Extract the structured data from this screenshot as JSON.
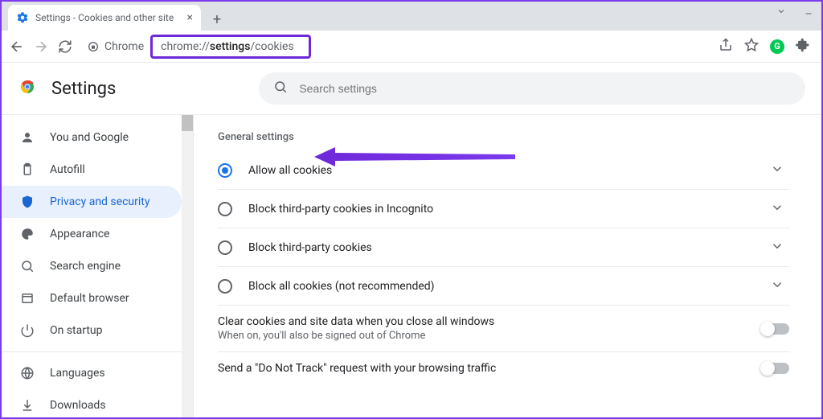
{
  "browser": {
    "tab_title": "Settings - Cookies and other site",
    "new_tab_label": "+",
    "address_prefix": "Chrome",
    "address_url_before": "chrome://",
    "address_url_bold": "settings",
    "address_url_after": "/cookies"
  },
  "settings": {
    "app_title": "Settings",
    "search_placeholder": "Search settings",
    "sidebar": {
      "items": [
        {
          "label": "You and Google",
          "icon": "person"
        },
        {
          "label": "Autofill",
          "icon": "clipboard"
        },
        {
          "label": "Privacy and security",
          "icon": "shield",
          "active": true
        },
        {
          "label": "Appearance",
          "icon": "palette"
        },
        {
          "label": "Search engine",
          "icon": "search"
        },
        {
          "label": "Default browser",
          "icon": "window"
        },
        {
          "label": "On startup",
          "icon": "power"
        }
      ],
      "items_more": [
        {
          "label": "Languages",
          "icon": "globe"
        },
        {
          "label": "Downloads",
          "icon": "download"
        }
      ]
    },
    "section_title": "General settings",
    "radio_options": [
      {
        "label": "Allow all cookies",
        "selected": true
      },
      {
        "label": "Block third-party cookies in Incognito",
        "selected": false
      },
      {
        "label": "Block third-party cookies",
        "selected": false
      },
      {
        "label": "Block all cookies (not recommended)",
        "selected": false
      }
    ],
    "toggle_rows": [
      {
        "title": "Clear cookies and site data when you close all windows",
        "sub": "When on, you'll also be signed out of Chrome",
        "on": false
      },
      {
        "title": "Send a \"Do Not Track\" request with your browsing traffic",
        "sub": "",
        "on": false
      }
    ]
  },
  "annotation": {
    "highlight_color": "#6d28d9"
  }
}
